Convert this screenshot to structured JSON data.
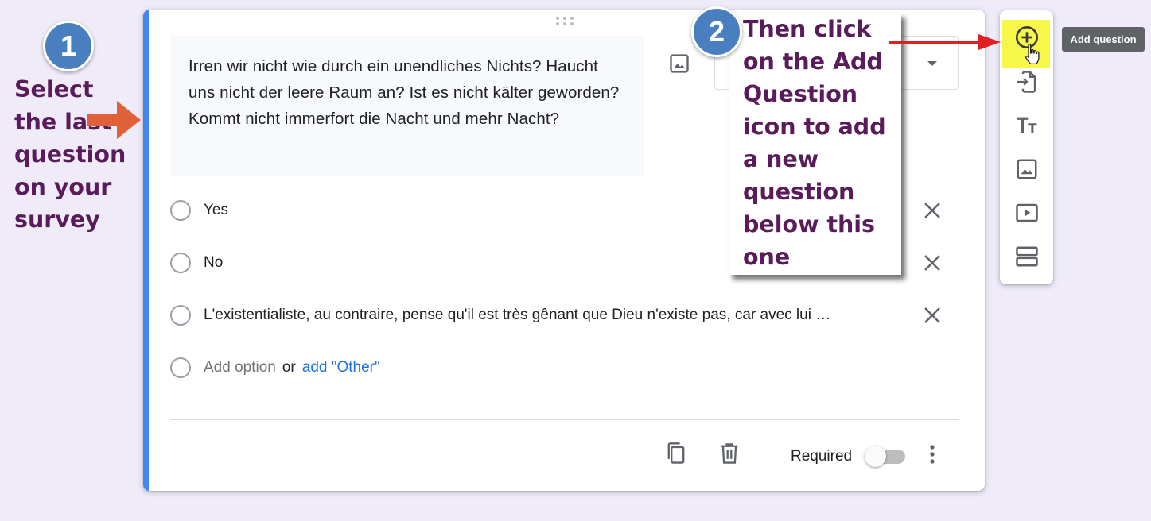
{
  "question": {
    "title": "Irren wir nicht wie durch ein unendliches Nichts? Haucht uns nicht der leere Raum an? Ist es nicht kälter geworden? Kommt nicht immerfort die Nacht und mehr Nacht?",
    "options": [
      {
        "label": "Yes"
      },
      {
        "label": "No"
      },
      {
        "label": "L'existentialiste, au contraire, pense qu'il est très gênant que Dieu n'existe pas, car avec lui …"
      }
    ],
    "add_option_label": "Add option",
    "or_label": "or",
    "add_other_label": "add \"Other\"",
    "required_label": "Required",
    "required_on": false
  },
  "toolbar": {
    "tooltip": "Add question",
    "items": [
      "add-question",
      "import-questions",
      "add-title-description",
      "add-image",
      "add-video",
      "add-section"
    ]
  },
  "annotations": {
    "step1_number": "1",
    "step1_text": "Select the last question on your survey",
    "step2_number": "2",
    "step2_text": "Then click on the Add Question icon to add a new question below this one"
  },
  "colors": {
    "accent": "#4285f4",
    "link": "#1a73e8",
    "annotation_text": "#5a1b5a",
    "badge": "#4a7fbf",
    "highlight": "#f7f74a",
    "arrow_orange": "#e0603a",
    "arrow_red": "#e02020"
  }
}
